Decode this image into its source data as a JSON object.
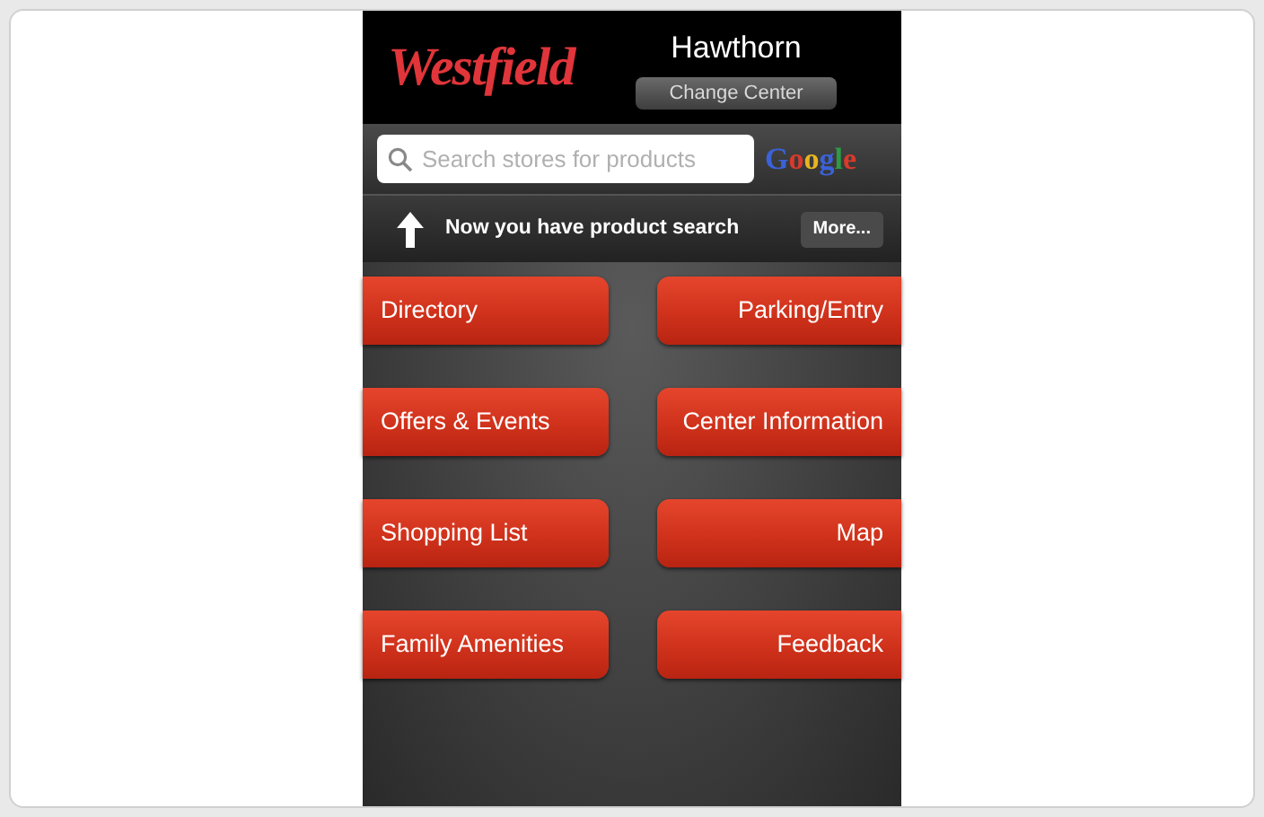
{
  "header": {
    "logo": "Westfield",
    "center_name": "Hawthorn",
    "change_button": "Change Center"
  },
  "search": {
    "placeholder": "Search stores for products",
    "provider": "Google"
  },
  "banner": {
    "text": "Now you have product search",
    "more_button": "More..."
  },
  "menu": [
    {
      "label": "Directory",
      "kind": "left"
    },
    {
      "label": "Parking/Entry",
      "kind": "right"
    },
    {
      "label": "Offers & Events",
      "kind": "left"
    },
    {
      "label": "Center Information",
      "kind": "right"
    },
    {
      "label": "Shopping List",
      "kind": "left"
    },
    {
      "label": "Map",
      "kind": "right"
    },
    {
      "label": "Family Amenities",
      "kind": "left"
    },
    {
      "label": "Feedback",
      "kind": "right"
    }
  ]
}
